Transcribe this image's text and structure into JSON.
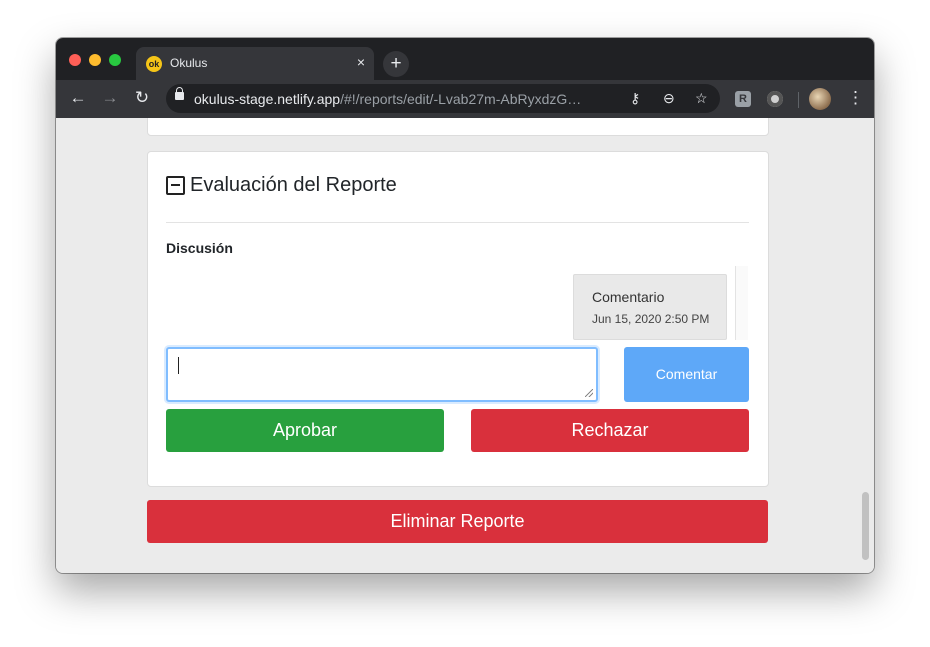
{
  "browser": {
    "tab": {
      "favicon_text": "ok",
      "title": "Okulus",
      "close_glyph": "×"
    },
    "new_tab_glyph": "+",
    "nav": {
      "back": "←",
      "forward": "→",
      "reload": "↻"
    },
    "address": {
      "host": "okulus-stage.netlify.app",
      "path": "/#!/reports/edit/-Lvab27m-AbRyxdzG…"
    },
    "extensions": {
      "r_label": "R"
    },
    "menu_glyph": "⋮"
  },
  "evaluation": {
    "title": "Evaluación del Reporte",
    "discussion_label": "Discusión",
    "comments": [
      {
        "text": "Comentario",
        "timestamp": "Jun 15, 2020 2:50 PM"
      }
    ],
    "input_value": "",
    "comment_button": "Comentar",
    "approve_button": "Aprobar",
    "reject_button": "Rechazar"
  },
  "delete_button": "Eliminar Reporte",
  "colors": {
    "approve": "#28a03e",
    "reject": "#d9303c",
    "comment": "#5ea8f8"
  }
}
